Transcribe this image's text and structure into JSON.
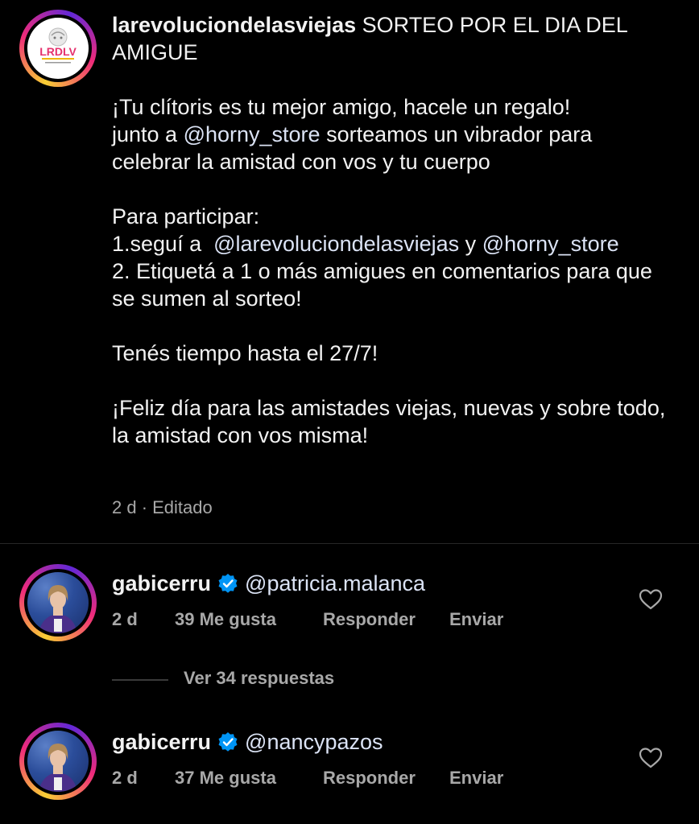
{
  "post": {
    "username": "larevoluciondelasviejas",
    "title": " SORTEO POR EL DIA DEL AMIGUE",
    "avatar_text": "LRDLV",
    "avatar_icon": "brand-logo-icon",
    "body_line1": "¡Tu clítoris es tu mejor amigo, hacele un regalo!",
    "body_line2_a": "junto a ",
    "body_line2_mention": "@horny_store",
    "body_line2_b": " sorteamos un vibrador para celebrar la amistad con vos y tu cuerpo",
    "participate_heading": "Para participar:",
    "step1_a": "1.seguí a  ",
    "step1_mention1": "@larevoluciondelasviejas",
    "step1_b": " y ",
    "step1_mention2": "@horny_store",
    "step2": "2. Etiquetá a 1 o más amigues en comentarios para que se sumen al sorteo!",
    "deadline": "Tenés tiempo hasta el 27/7!",
    "closing": "¡Feliz día para las amistades viejas, nuevas y sobre todo, la amistad con vos misma!",
    "meta": "2 d · Editado"
  },
  "comments": [
    {
      "username": "gabicerru",
      "verified_icon": "verified-badge-icon",
      "text": "@patricia.malanca",
      "time": "2 d",
      "likes": "39 Me gusta",
      "reply_label": "Responder",
      "send_label": "Enviar",
      "like_icon": "heart-icon"
    },
    {
      "username": "gabicerru",
      "verified_icon": "verified-badge-icon",
      "text": "@nancypazos",
      "time": "2 d",
      "likes": "37 Me gusta",
      "reply_label": "Responder",
      "send_label": "Enviar",
      "like_icon": "heart-icon"
    }
  ],
  "replies_toggle": "Ver 34 respuestas",
  "colors": {
    "background": "#000000",
    "text": "#f2f2f2",
    "mention": "#dbe3f5",
    "secondary": "#a8a8a8",
    "verified": "#0095f6"
  }
}
